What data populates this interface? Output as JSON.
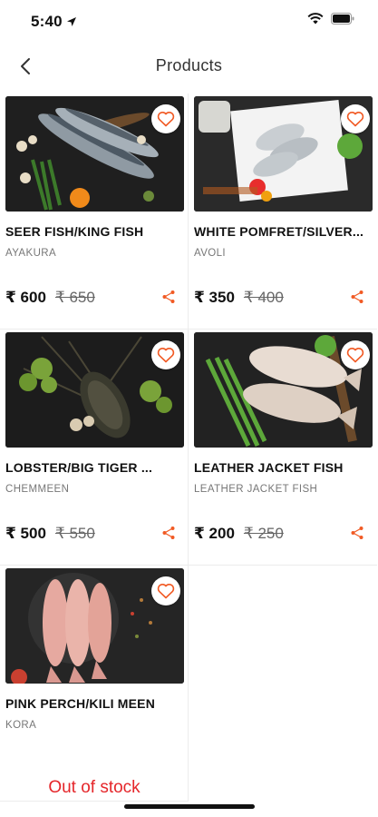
{
  "status": {
    "time": "5:40"
  },
  "header": {
    "title": "Products"
  },
  "colors": {
    "accent": "#f15a24",
    "out_of_stock": "#e5262a"
  },
  "products": [
    {
      "name": "SEER FISH/KING FISH",
      "subtitle": "AYAKURA",
      "price": "₹ 600",
      "mrp": "₹ 650"
    },
    {
      "name": "WHITE POMFRET/SILVER...",
      "subtitle": "AVOLI",
      "price": "₹ 350",
      "mrp": "₹ 400"
    },
    {
      "name": "LOBSTER/BIG TIGER ...",
      "subtitle": "CHEMMEEN",
      "price": "₹ 500",
      "mrp": "₹ 550"
    },
    {
      "name": "LEATHER JACKET FISH",
      "subtitle": "LEATHER JACKET FISH",
      "price": "₹ 200",
      "mrp": "₹ 250"
    },
    {
      "name": "PINK PERCH/KILI MEEN",
      "subtitle": "KORA",
      "status": "Out of stock"
    }
  ]
}
